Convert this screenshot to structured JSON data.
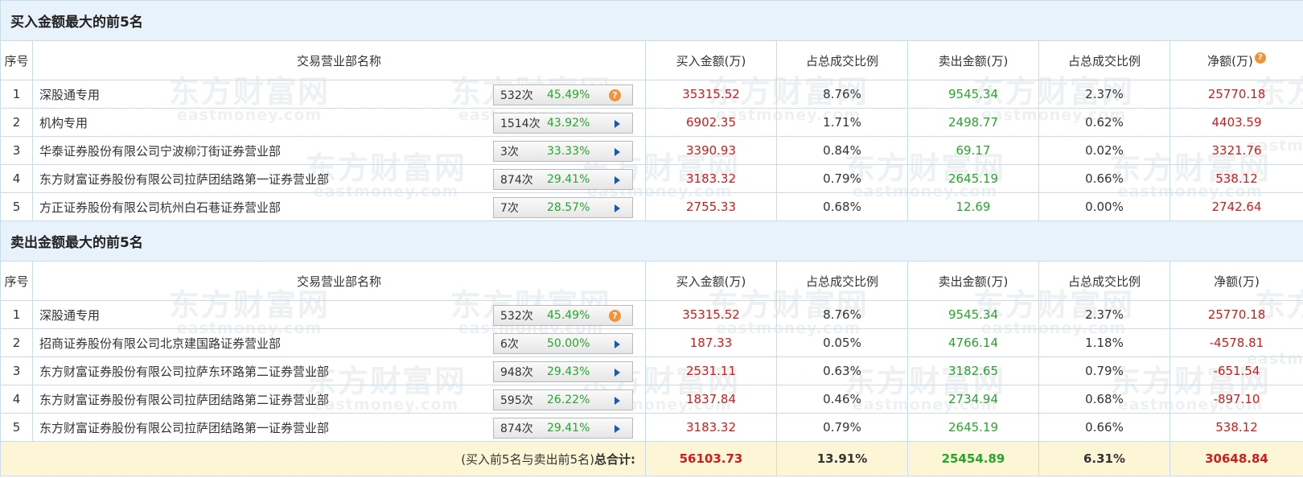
{
  "buy_section": {
    "title": "买入金额最大的前5名",
    "headers": [
      "序号",
      "交易营业部名称",
      "买入金额(万)",
      "占总成交比例",
      "卖出金额(万)",
      "占总成交比例",
      "净额(万)"
    ],
    "header_icon": "?",
    "rows": [
      {
        "idx": "1",
        "name": "深股通专用",
        "count": "532次",
        "pct": "45.49%",
        "icon": "?",
        "buy": "35315.52",
        "buy_ratio": "8.76%",
        "sell": "9545.34",
        "sell_ratio": "2.37%",
        "net": "25770.18"
      },
      {
        "idx": "2",
        "name": "机构专用",
        "count": "1514次",
        "pct": "43.92%",
        "icon": "▶",
        "buy": "6902.35",
        "buy_ratio": "1.71%",
        "sell": "2498.77",
        "sell_ratio": "0.62%",
        "net": "4403.59"
      },
      {
        "idx": "3",
        "name": "华泰证券股份有限公司宁波柳汀街证券营业部",
        "count": "3次",
        "pct": "33.33%",
        "icon": "▶",
        "buy": "3390.93",
        "buy_ratio": "0.84%",
        "sell": "69.17",
        "sell_ratio": "0.02%",
        "net": "3321.76"
      },
      {
        "idx": "4",
        "name": "东方财富证券股份有限公司拉萨团结路第一证券营业部",
        "count": "874次",
        "pct": "29.41%",
        "icon": "▶",
        "buy": "3183.32",
        "buy_ratio": "0.79%",
        "sell": "2645.19",
        "sell_ratio": "0.66%",
        "net": "538.12"
      },
      {
        "idx": "5",
        "name": "方正证券股份有限公司杭州白石巷证券营业部",
        "count": "7次",
        "pct": "28.57%",
        "icon": "▶",
        "buy": "2755.33",
        "buy_ratio": "0.68%",
        "sell": "12.69",
        "sell_ratio": "0.00%",
        "net": "2742.64"
      }
    ]
  },
  "sell_section": {
    "title": "卖出金额最大的前5名",
    "headers": [
      "序号",
      "交易营业部名称",
      "买入金额(万)",
      "占总成交比例",
      "卖出金额(万)",
      "占总成交比例",
      "净额(万)"
    ],
    "rows": [
      {
        "idx": "1",
        "name": "深股通专用",
        "count": "532次",
        "pct": "45.49%",
        "icon": "?",
        "buy": "35315.52",
        "buy_ratio": "8.76%",
        "sell": "9545.34",
        "sell_ratio": "2.37%",
        "net": "25770.18"
      },
      {
        "idx": "2",
        "name": "招商证券股份有限公司北京建国路证券营业部",
        "count": "6次",
        "pct": "50.00%",
        "icon": "▶",
        "buy": "187.33",
        "buy_ratio": "0.05%",
        "sell": "4766.14",
        "sell_ratio": "1.18%",
        "net": "-4578.81"
      },
      {
        "idx": "3",
        "name": "东方财富证券股份有限公司拉萨东环路第二证券营业部",
        "count": "948次",
        "pct": "29.43%",
        "icon": "▶",
        "buy": "2531.11",
        "buy_ratio": "0.63%",
        "sell": "3182.65",
        "sell_ratio": "0.79%",
        "net": "-651.54"
      },
      {
        "idx": "4",
        "name": "东方财富证券股份有限公司拉萨团结路第二证券营业部",
        "count": "595次",
        "pct": "26.22%",
        "icon": "▶",
        "buy": "1837.84",
        "buy_ratio": "0.46%",
        "sell": "2734.94",
        "sell_ratio": "0.68%",
        "net": "-897.10"
      },
      {
        "idx": "5",
        "name": "东方财富证券股份有限公司拉萨团结路第一证券营业部",
        "count": "874次",
        "pct": "29.41%",
        "icon": "▶",
        "buy": "3183.32",
        "buy_ratio": "0.79%",
        "sell": "2645.19",
        "sell_ratio": "0.66%",
        "net": "538.12"
      }
    ]
  },
  "total": {
    "label_prefix": "(买入前5名与卖出前5名)",
    "label_bold": "总合计:",
    "buy": "56103.73",
    "buy_ratio": "13.91%",
    "sell": "25454.89",
    "sell_ratio": "6.31%",
    "net": "30648.84"
  },
  "watermark": {
    "big": "东方财富网",
    "small": "eastmoney.com"
  },
  "colors": {
    "buy": "#d01c1c",
    "sell": "#28a52e",
    "section_bg": "#e8f2fb",
    "border": "#c9dcee",
    "total_bg": "#fdf6d6",
    "help_icon": "#f39237",
    "arrow": "#1f5aa6"
  }
}
